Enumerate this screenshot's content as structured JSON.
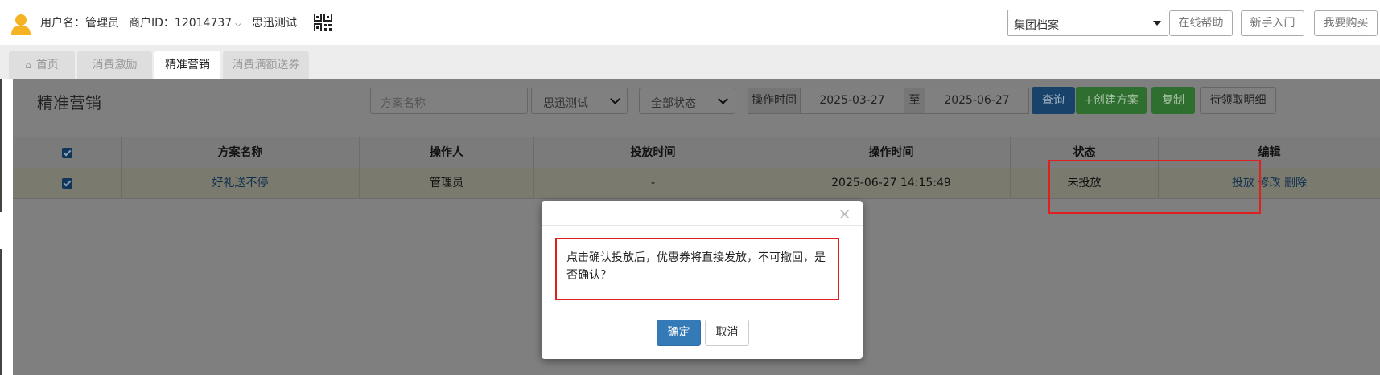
{
  "header": {
    "username_label": "用户名：管理员",
    "merchant_label": "商户ID：12014737",
    "store_name": "思迅测试",
    "group_select": "集团档案",
    "buttons": [
      "在线帮助",
      "新手入门",
      "我要购买"
    ]
  },
  "tabs": [
    {
      "label": "首页",
      "active": false
    },
    {
      "label": "消费激励",
      "active": false
    },
    {
      "label": "精准营销",
      "active": true
    },
    {
      "label": "消费满额送券",
      "active": false
    }
  ],
  "page": {
    "title": "精准营销",
    "search_placeholder": "方案名称",
    "store_filter": "思迅测试",
    "status_filter": "全部状态",
    "time_label": "操作时间",
    "date_from": "2025-03-27",
    "date_sep": "至",
    "date_to": "2025-06-27",
    "query_button": "查询",
    "create_button": "+创建方案",
    "copy_button": "复制",
    "pending_button": "待领取明细"
  },
  "table": {
    "columns": [
      "方案名称",
      "操作人",
      "投放时间",
      "操作时间",
      "状态",
      "编辑"
    ],
    "rows": [
      {
        "name": "好礼送不停",
        "operator": "管理员",
        "launch_time": "-",
        "op_time": "2025-06-27 14:15:49",
        "status": "未投放",
        "actions": [
          "投放",
          "修改",
          "删除"
        ]
      }
    ]
  },
  "modal": {
    "close_glyph": "×",
    "message": "点击确认投放后，优惠券将直接发放，不可撤回，是否确认？",
    "confirm": "确定",
    "cancel": "取消"
  },
  "colors": {
    "primary": "#337ab7",
    "success": "#5cb85c",
    "highlight_frame": "#e02020",
    "link": "#337ab7"
  }
}
